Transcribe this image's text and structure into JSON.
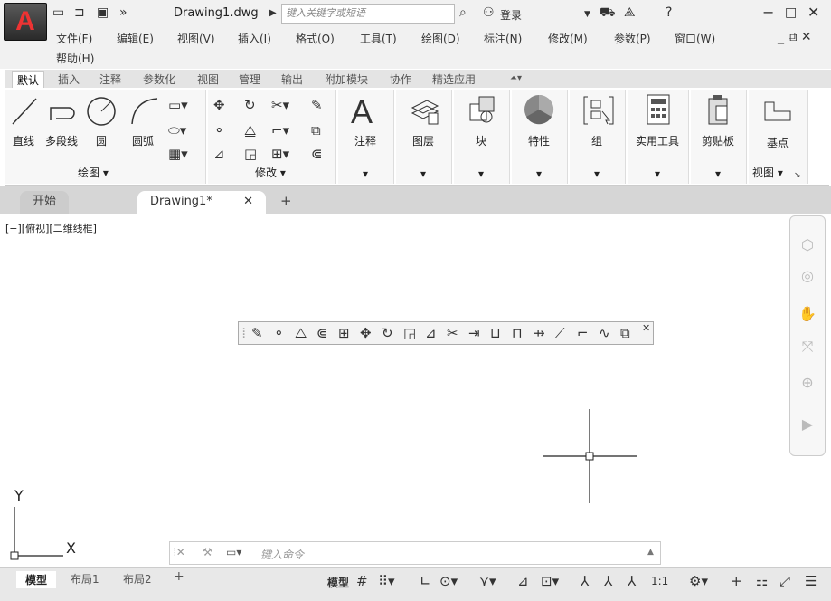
{
  "app": {
    "logo": "A",
    "title": "Drawing1.dwg",
    "search_placeholder": "键入关键字或短语",
    "login": "登录"
  },
  "menu": [
    "文件(F)",
    "编辑(E)",
    "视图(V)",
    "插入(I)",
    "格式(O)",
    "工具(T)",
    "绘图(D)",
    "标注(N)",
    "修改(M)",
    "参数(P)",
    "窗口(W)",
    "帮助(H)"
  ],
  "ribbon_tabs": [
    "默认",
    "插入",
    "注释",
    "参数化",
    "视图",
    "管理",
    "输出",
    "附加模块",
    "协作",
    "精选应用"
  ],
  "draw_panel": {
    "items": [
      "直线",
      "多段线",
      "圆",
      "圆弧"
    ],
    "title": "绘图 ▾"
  },
  "modify_panel": {
    "title": "修改 ▾"
  },
  "big_buttons": [
    "注释",
    "图层",
    "块",
    "特性",
    "组",
    "实用工具",
    "剪贴板",
    "基点"
  ],
  "view_panel_title": "视图 ▾",
  "doc_tabs": {
    "start": "开始",
    "current": "Drawing1*"
  },
  "canvas": {
    "view_label": "[−][俯视][二维线框]",
    "axis_y": "Y",
    "axis_x": "X"
  },
  "command": {
    "placeholder": "键入命令"
  },
  "layout_tabs": [
    "模型",
    "布局1",
    "布局2"
  ],
  "status": {
    "model": "模型",
    "scale": "1:1"
  }
}
